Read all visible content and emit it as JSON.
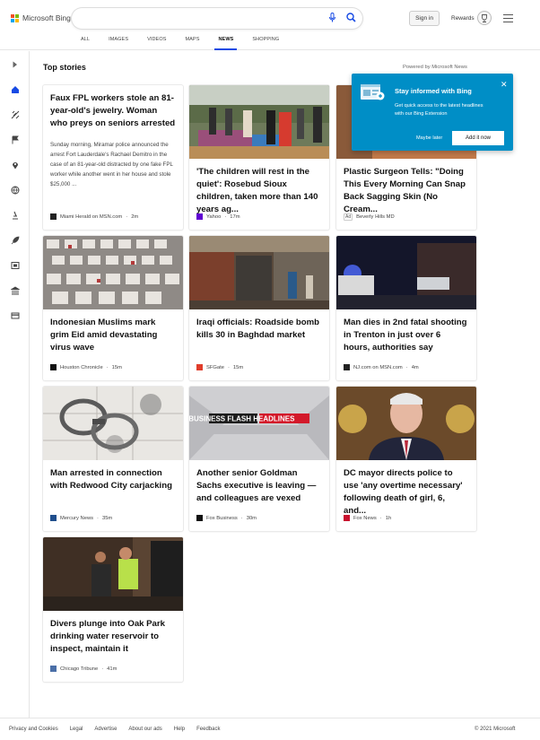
{
  "header": {
    "brand": "Microsoft Bing",
    "search_value": "",
    "signin_label": "Sign in",
    "rewards_label": "Rewards"
  },
  "tabs": [
    {
      "label": "ALL",
      "active": false
    },
    {
      "label": "IMAGES",
      "active": false
    },
    {
      "label": "VIDEOS",
      "active": false
    },
    {
      "label": "MAPS",
      "active": false
    },
    {
      "label": "NEWS",
      "active": true
    },
    {
      "label": "SHOPPING",
      "active": false
    }
  ],
  "sidebar_icons": [
    "chevron-right-icon",
    "home-icon",
    "satellite-icon",
    "flag-icon",
    "location-pin-icon",
    "globe-icon",
    "microscope-icon",
    "rocket-icon",
    "film-icon",
    "bank-icon",
    "credit-card-icon"
  ],
  "main": {
    "section_title": "Top stories",
    "powered_by": "Powered by Microsoft News"
  },
  "popup": {
    "title": "Stay informed with Bing",
    "description": "Get quick access to the latest headlines with our Bing Extension",
    "later_label": "Maybe later",
    "add_label": "Add it now"
  },
  "cards": [
    {
      "title": "Faux FPL workers stole an 81-year-old's jewelry. Woman who preys on seniors arrested",
      "snippet": "Sunday morning, Miramar police announced the arrest Fort Lauderdale's Rachael Demitro in the case of an 81-year-old distracted by one fake FPL worker while another went in her house and stole $25,000 ...",
      "source": "Miami Herald on MSN.com",
      "time": "2m"
    },
    {
      "title": "'The children will rest in the quiet': Rosebud Sioux children, taken more than 140 years ag...",
      "source": "Yahoo",
      "time": "17m"
    },
    {
      "title": "Plastic Surgeon Tells: \"Doing This Every Morning Can Snap Back Sagging Skin (No Cream...",
      "source": "Beverly Hills MD",
      "ad_label": "Ad"
    },
    {
      "title": "Indonesian Muslims mark grim Eid amid devastating virus wave",
      "source": "Houston Chronicle",
      "time": "15m"
    },
    {
      "title": "Iraqi officials: Roadside bomb kills 30 in Baghdad market",
      "source": "SFGate",
      "time": "15m"
    },
    {
      "title": "Man dies in 2nd fatal shooting in Trenton in just over 6 hours, authorities say",
      "source": "NJ.com on MSN.com",
      "time": "4m"
    },
    {
      "title": "Man arrested in connection with Redwood City carjacking",
      "source": "Mercury News",
      "time": "35m"
    },
    {
      "title": "Another senior Goldman Sachs executive is leaving — and colleagues are vexed",
      "source": "Fox Business",
      "time": "30m",
      "image_text": "FOX BUSINESS FLASH HEADLINES"
    },
    {
      "title": "DC mayor directs police to use 'any overtime necessary' following death of girl, 6, and...",
      "source": "Fox News",
      "time": "1h"
    },
    {
      "title": "Divers plunge into Oak Park drinking water reservoir to inspect, maintain it",
      "source": "Chicago Tribune",
      "time": "41m"
    }
  ],
  "footer": {
    "links": [
      "Privacy and Cookies",
      "Legal",
      "Advertise",
      "About our ads",
      "Help",
      "Feedback"
    ],
    "copyright": "© 2021 Microsoft"
  }
}
